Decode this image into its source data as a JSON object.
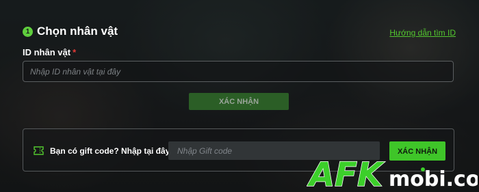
{
  "section": {
    "step_number": "1",
    "title": "Chọn nhân vật",
    "guide_link": "Hướng dẫn tìm ID"
  },
  "character_id": {
    "label": "ID nhân vật",
    "required_mark": "*",
    "placeholder": "Nhập ID nhân vật tại đây",
    "value": "",
    "confirm_label": "XÁC NHẬN"
  },
  "gift_code": {
    "label": "Bạn có gift code? Nhập tại đây:",
    "placeholder": "Nhập Gift code",
    "value": "",
    "confirm_label": "XÁC NHẬN",
    "icon": "ticket-icon"
  },
  "watermark": {
    "brand": "AFKmobi.com"
  },
  "colors": {
    "accent_green": "#53c82f",
    "button_green": "#3fc529",
    "disabled_button": "#2b5e26",
    "required_red": "#e53935",
    "background": "#181b1d"
  }
}
